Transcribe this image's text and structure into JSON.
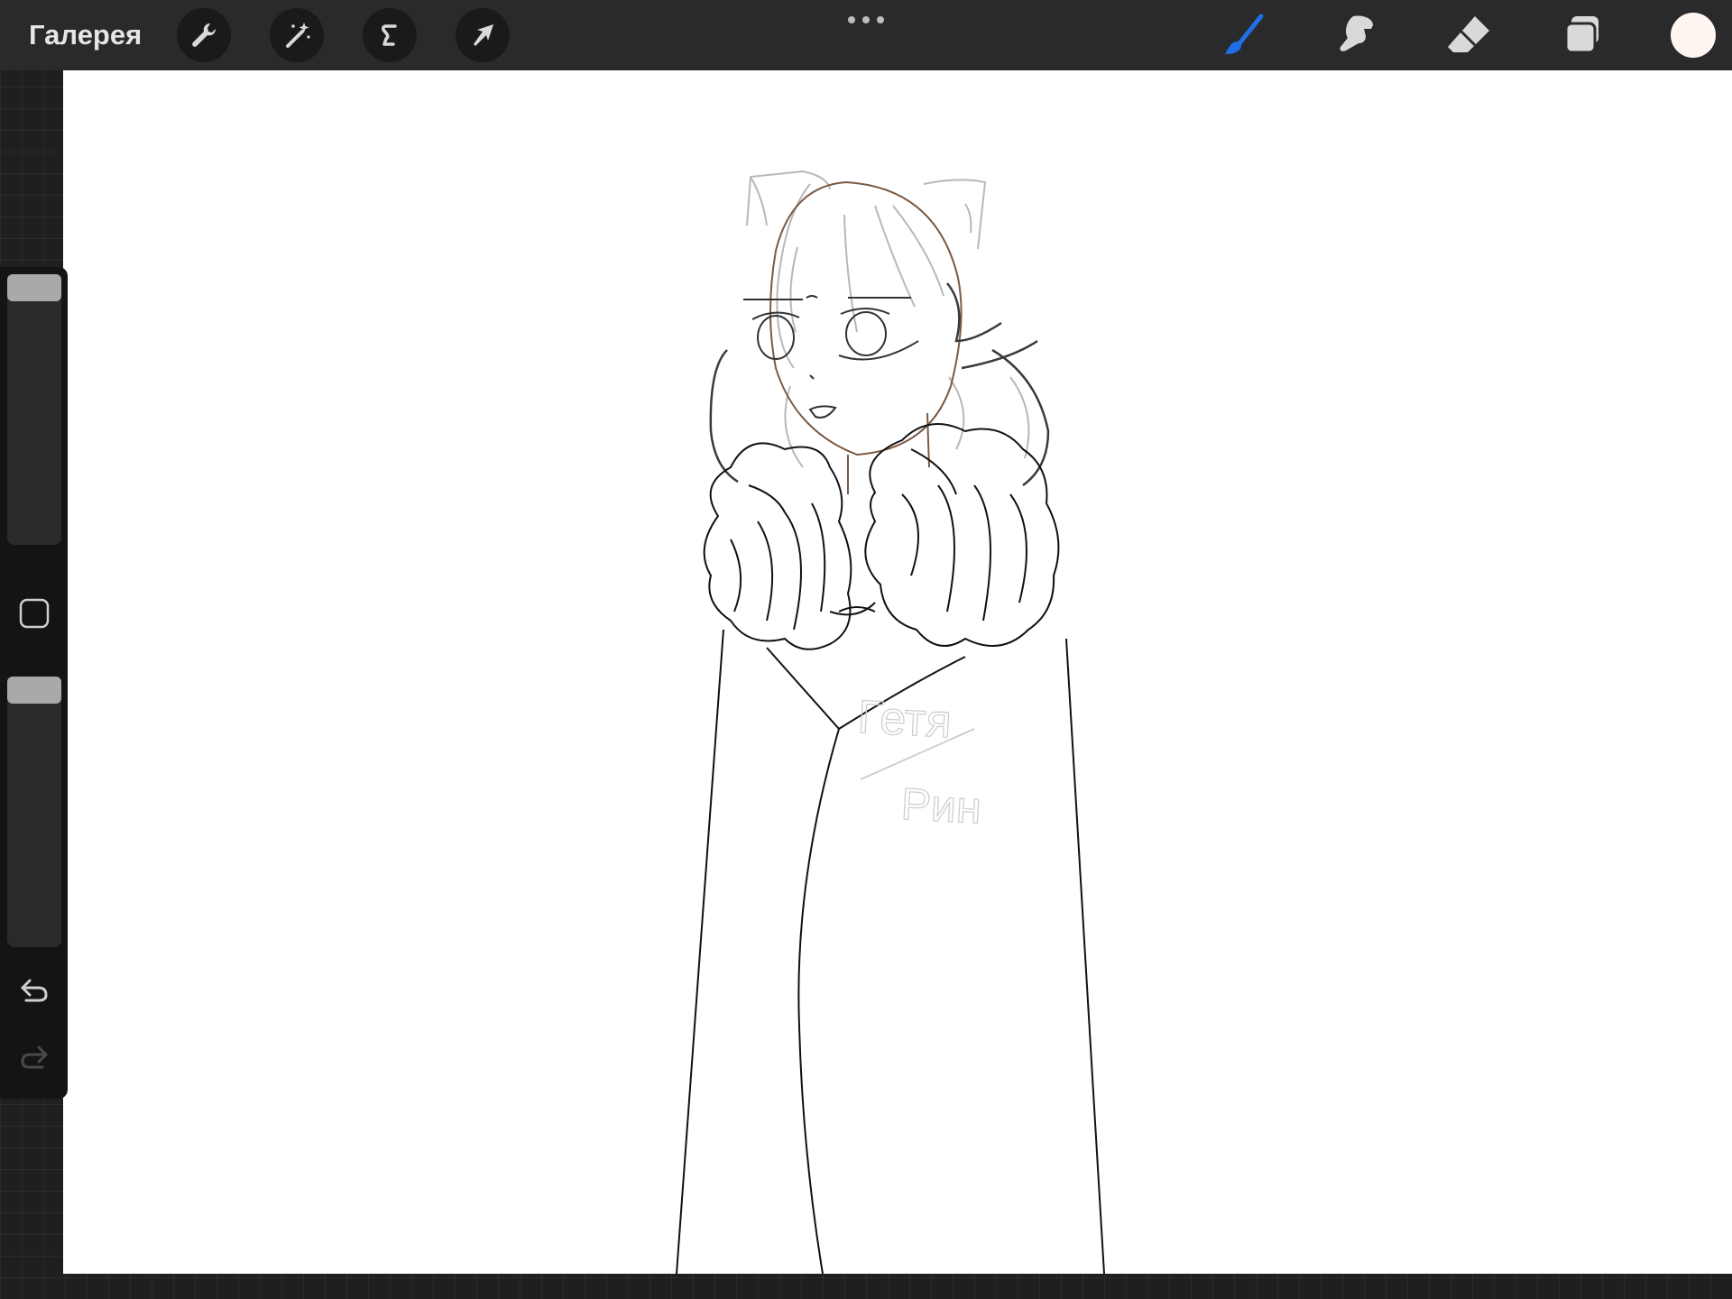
{
  "toolbar": {
    "gallery_label": "Галерея",
    "left_tools": [
      {
        "name": "actions",
        "icon": "wrench-icon"
      },
      {
        "name": "adjustments",
        "icon": "magic-wand-icon"
      },
      {
        "name": "selection",
        "icon": "selection-s-icon"
      },
      {
        "name": "transform",
        "icon": "arrow-cursor-icon"
      }
    ],
    "more_icon": "more-dots-icon",
    "right_tools": [
      {
        "name": "brush",
        "icon": "brush-icon",
        "active": true
      },
      {
        "name": "smudge",
        "icon": "smudge-finger-icon",
        "active": false
      },
      {
        "name": "eraser",
        "icon": "eraser-icon",
        "active": false
      },
      {
        "name": "layers",
        "icon": "layers-icon",
        "active": false
      }
    ],
    "current_color": "#fff6f2",
    "accent_color": "#1f6fe8"
  },
  "sidebar": {
    "brush_size_level": 0.0,
    "modify_button_icon": "square-modify-icon",
    "opacity_level": 0.0,
    "undo_icon": "undo-icon",
    "redo_icon": "redo-icon",
    "redo_enabled": false
  },
  "canvas": {
    "signature_lines": [
      "Гетя",
      "Рин"
    ]
  }
}
